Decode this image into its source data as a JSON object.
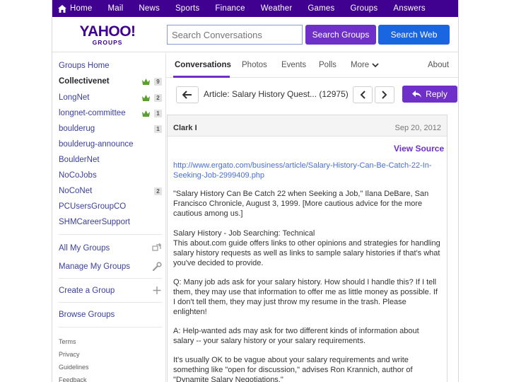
{
  "topnav": {
    "items": [
      "Home",
      "Mail",
      "News",
      "Sports",
      "Finance",
      "Weather",
      "Games",
      "Groups",
      "Answers"
    ]
  },
  "header": {
    "logo_text": "YAHOO!",
    "logo_sub": "GROUPS",
    "search_placeholder": "Search Conversations",
    "search_groups_label": "Search Groups",
    "search_web_label": "Search Web"
  },
  "sidebar": {
    "groups_home": "Groups Home",
    "groups": [
      {
        "label": "Collectivenet",
        "bold": true,
        "crown": true,
        "count": "9"
      },
      {
        "label": "LongNet",
        "bold": false,
        "crown": true,
        "count": "2"
      },
      {
        "label": "longnet-committee",
        "bold": false,
        "crown": true,
        "count": "1"
      },
      {
        "label": "boulderug",
        "bold": false,
        "crown": false,
        "count": "1"
      },
      {
        "label": "boulderug-announce",
        "bold": false,
        "crown": false,
        "count": ""
      },
      {
        "label": "BoulderNet",
        "bold": false,
        "crown": false,
        "count": ""
      },
      {
        "label": "NoCoJobs",
        "bold": false,
        "crown": false,
        "count": ""
      },
      {
        "label": "NoCoNet",
        "bold": false,
        "crown": false,
        "count": "2"
      },
      {
        "label": "PCUsersGroupCO",
        "bold": false,
        "crown": false,
        "count": ""
      },
      {
        "label": "SHMCareerSupport",
        "bold": false,
        "crown": false,
        "count": ""
      }
    ],
    "all_groups": "All My Groups",
    "manage_groups": "Manage My Groups",
    "create_group": "Create a Group",
    "browse_groups": "Browse Groups",
    "footer_links": [
      "Terms",
      "Privacy",
      "Guidelines",
      "Feedback"
    ]
  },
  "tabs": {
    "items": [
      "Conversations",
      "Photos",
      "Events",
      "Polls",
      "More"
    ],
    "about": "About"
  },
  "message": {
    "subject": "Article: Salary History Quest... (12975)",
    "reply_label": "Reply",
    "author": "Clark I",
    "date": "Sep 20, 2012",
    "view_source": "View Source",
    "link": "http://www.ergato.com/business/article/Salary-History-Can-Be-Catch-22-In-Seeking-Job-2999409.php",
    "paragraphs": [
      "\"Salary History Can Be Catch 22 when Seeking a Job,\" Ilana DeBare, San Francisco Chronicle, August 3, 1999. [More cautious advice for the more cautious among us.]",
      "Salary History - Job Searching: Technical\nThis about.com guide offers links to other opinions and strategies for handling salary history requests as well as links to sample salary histories if that's what you've decided to provide.",
      "Q: Many job ads ask for your salary history. How should I handle this? If I tell them, they may use that information to offer me as little money as possible. If I don't tell them, they may just throw my resume in the trash. Please enlighten!",
      "A: Help-wanted ads may ask for two different kinds of information about salary -- your salary history or your salary requirements.",
      "It's usually OK to be vague about your salary requirements and write something like \"open for discussion,\" advises Ron Krannich, author of \"Dynamite Salary Negotiations.\""
    ]
  },
  "colors": {
    "brand_purple": "#400090",
    "accent_purple": "#6e30c8",
    "web_blue": "#1a66e0",
    "crown_green": "#5aa02c"
  }
}
